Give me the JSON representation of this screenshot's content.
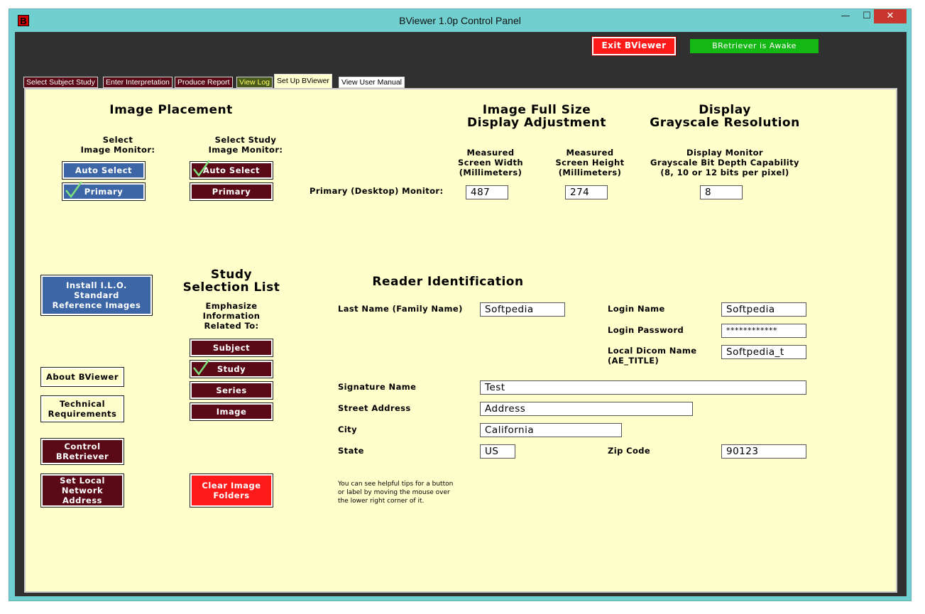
{
  "window": {
    "title": "BViewer 1.0p Control Panel",
    "app_icon": "B",
    "min_glyph": "—",
    "max_glyph": "☐",
    "close_glyph": "✕"
  },
  "header": {
    "exit_label": "Exit BViewer",
    "status_label": "BRetriever is Awake"
  },
  "tabs": [
    {
      "label": "Select Subject Study"
    },
    {
      "label": "Enter Interpretation"
    },
    {
      "label": "Produce Report"
    },
    {
      "label": "View Log"
    },
    {
      "label": "Set Up BViewer"
    },
    {
      "label": "View User Manual"
    }
  ],
  "image_placement": {
    "title": "Image Placement",
    "image_monitor_label": "Select\nImage Monitor:",
    "study_monitor_label": "Select Study\nImage Monitor:",
    "auto_select": "Auto Select",
    "primary": "Primary"
  },
  "full_size": {
    "title": "Image Full Size\nDisplay Adjustment",
    "width_label": "Measured\nScreen Width\n(Millimeters)",
    "height_label": "Measured\nScreen Height\n(Millimeters)",
    "row_label": "Primary (Desktop) Monitor:",
    "width_value": "487",
    "height_value": "274"
  },
  "grayscale": {
    "title": "Display\nGrayscale Resolution",
    "label": "Display Monitor\nGrayscale Bit Depth Capability\n(8, 10 or 12 bits per pixel)",
    "value": "8"
  },
  "left_buttons": {
    "install_ilo": "Install I.L.O.\nStandard\nReference Images",
    "about": "About BViewer",
    "technical": "Technical\nRequirements",
    "control": "Control\nBRetriever",
    "set_local": "Set Local\nNetwork\nAddress"
  },
  "study_selection": {
    "title": "Study\nSelection List",
    "emphasize_label": "Emphasize\nInformation\nRelated To:",
    "subject": "Subject",
    "study": "Study",
    "series": "Series",
    "image": "Image",
    "clear_folders": "Clear Image\nFolders"
  },
  "reader": {
    "title": "Reader Identification",
    "last_name_label": "Last Name (Family Name)",
    "last_name": "Softpedia",
    "login_name_label": "Login Name",
    "login_name": "Softpedia",
    "login_password_label": "Login Password",
    "login_password": "************",
    "dicom_label": "Local Dicom Name\n(AE_TITLE)",
    "dicom": "Softpedia_t",
    "signature_label": "Signature Name",
    "signature": "Test",
    "street_label": "Street Address",
    "street": "Address",
    "city_label": "City",
    "city": "California",
    "state_label": "State",
    "state": "US",
    "zip_label": "Zip Code",
    "zip": "90123"
  },
  "tip_text": "You can see helpful tips for a button\nor label by moving the mouse over\nthe lower right corner of it.",
  "colors": {
    "frame": "#72cfd0",
    "panel": "#ffffcc",
    "maroon": "#5a0a16",
    "blue": "#3d66a7",
    "red": "#ff1a1a",
    "green": "#14b814",
    "check": "#7de07d"
  }
}
